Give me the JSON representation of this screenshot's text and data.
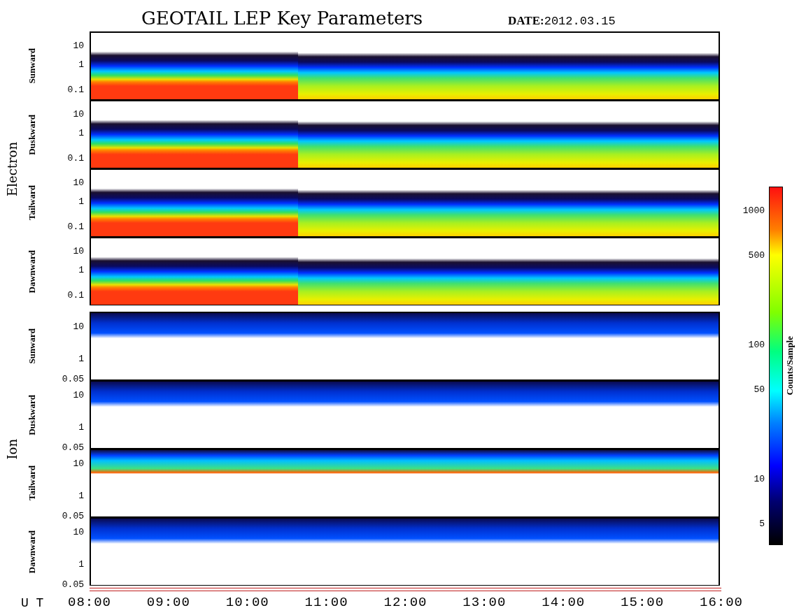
{
  "title": "GEOTAIL LEP Key Parameters",
  "date": {
    "label": "DATE:",
    "value": "2012.03.15"
  },
  "groups": [
    {
      "name": "Electron",
      "kind": "electron",
      "panels": [
        {
          "direction": "Sunward",
          "yticks": [
            "10",
            "1",
            "0.1"
          ]
        },
        {
          "direction": "Duskward",
          "yticks": [
            "10",
            "1",
            "0.1"
          ]
        },
        {
          "direction": "Tailward",
          "yticks": [
            "10",
            "1",
            "0.1"
          ]
        },
        {
          "direction": "Dawnward",
          "yticks": [
            "10",
            "1",
            "0.1"
          ]
        }
      ]
    },
    {
      "name": "Ion",
      "kind": "ion",
      "panels": [
        {
          "direction": "Sunward",
          "yticks": [
            "10",
            "1",
            "0.05"
          ]
        },
        {
          "direction": "Duskward",
          "yticks": [
            "10",
            "1",
            "0.05"
          ]
        },
        {
          "direction": "Tailward",
          "yticks": [
            "10",
            "1",
            "0.05"
          ]
        },
        {
          "direction": "Dawnward",
          "yticks": [
            "10",
            "1",
            "0.05"
          ]
        }
      ]
    }
  ],
  "colorbar": {
    "title": "Counts/Sample",
    "ticks": [
      "1000",
      "500",
      "100",
      "50",
      "10",
      "5"
    ]
  },
  "x_axis": {
    "label": "U T",
    "ticks": [
      "08:00",
      "09:00",
      "10:00",
      "11:00",
      "12:00",
      "13:00",
      "14:00",
      "15:00",
      "16:00"
    ]
  }
}
